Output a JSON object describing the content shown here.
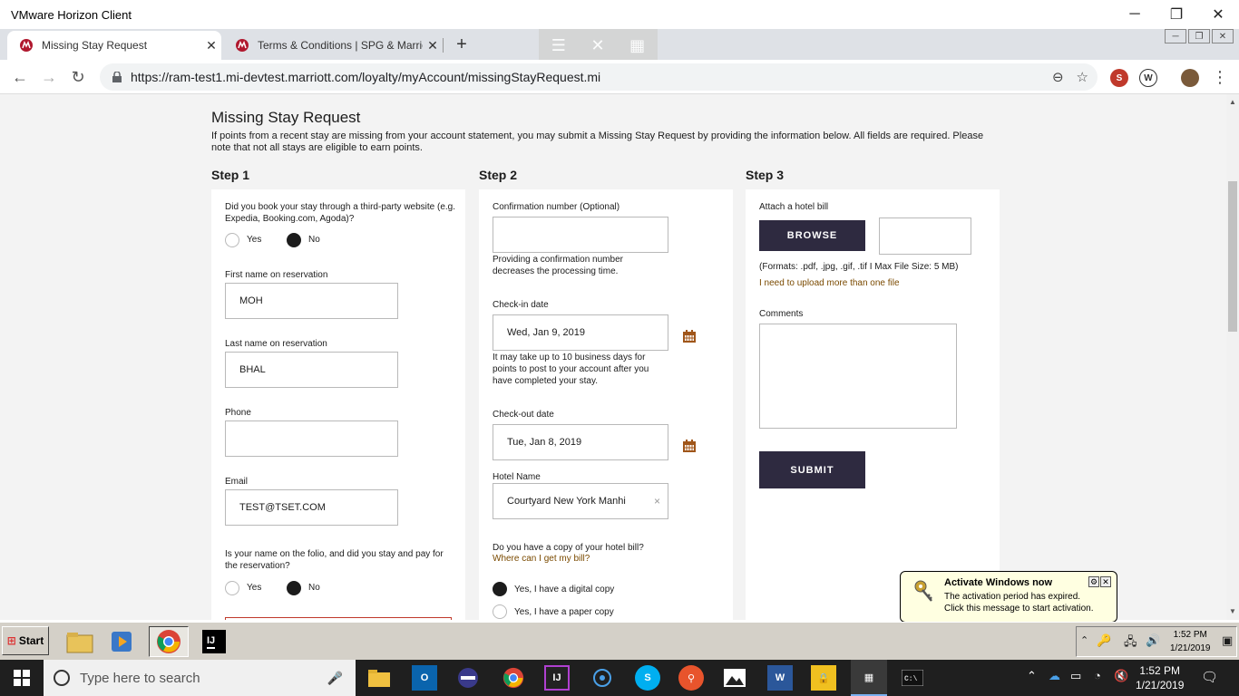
{
  "window": {
    "title": "VMware Horizon Client",
    "minimize": "─",
    "restore": "❐",
    "close": "✕"
  },
  "tabs": [
    {
      "label": "Missing Stay Request",
      "close": "✕"
    },
    {
      "label": "Terms & Conditions | SPG & Marriott",
      "close": "✕"
    }
  ],
  "new_tab": "+",
  "address": {
    "url": "https://ram-test1.mi-devtest.marriott.com/loyalty/myAccount/missingStayRequest.mi"
  },
  "page": {
    "title": "Missing Stay Request",
    "intro": "If points from a recent stay are missing from your account statement, you may submit a Missing Stay Request by providing the information below. All fields are required. Please note that not all stays are eligible to earn points.",
    "step1": {
      "heading": "Step 1",
      "third_party_q": "Did you book your stay through a third-party website (e.g. Expedia, Booking.com, Agoda)?",
      "yes": "Yes",
      "no": "No",
      "first_name_label": "First name on reservation",
      "first_name": "MOH",
      "last_name_label": "Last name on reservation",
      "last_name": "BHAL",
      "phone_label": "Phone",
      "phone": "",
      "email_label": "Email",
      "email": "TEST@TSET.COM",
      "folio_q": "Is your name on the folio, and did you stay and pay for the reservation?",
      "yes2": "Yes",
      "no2": "No"
    },
    "step2": {
      "heading": "Step 2",
      "confirmation_label": "Confirmation number (Optional)",
      "confirmation": "",
      "confirmation_help": "Providing a confirmation number decreases the processing time.",
      "checkin_label": "Check-in date",
      "checkin": "Wed, Jan 9, 2019",
      "checkin_help": "It may take up to 10 business days for points to post to your account after you have completed your stay.",
      "checkout_label": "Check-out date",
      "checkout": "Tue, Jan 8, 2019",
      "hotel_label": "Hotel Name",
      "hotel": "Courtyard New York Manhi",
      "hotel_clear": "×",
      "bill_q": "Do you have a copy of your hotel bill?",
      "bill_link": "Where can I get my bill?",
      "digital": "Yes, I have a digital copy",
      "paper": "Yes, I have a paper copy"
    },
    "step3": {
      "heading": "Step 3",
      "attach_label": "Attach a hotel bill",
      "browse": "BROWSE",
      "formats": "(Formats: .pdf, .jpg, .gif, .tif I Max File Size: 5 MB)",
      "more_files": "I need to upload more than one file",
      "comments_label": "Comments",
      "submit": "SUBMIT"
    }
  },
  "balloon": {
    "title": "Activate Windows now",
    "line1": "The activation period has expired.",
    "line2": "Click this message to start activation."
  },
  "remote_taskbar": {
    "start": "Start",
    "time": "1:52 PM",
    "date": "1/21/2019"
  },
  "win10_taskbar": {
    "search_placeholder": "Type here to search",
    "time": "1:52 PM",
    "date": "1/21/2019"
  },
  "colors": {
    "accent_brown": "#a0561a",
    "button_dark": "#2e2a40",
    "page_bg": "#f3f3f3"
  }
}
